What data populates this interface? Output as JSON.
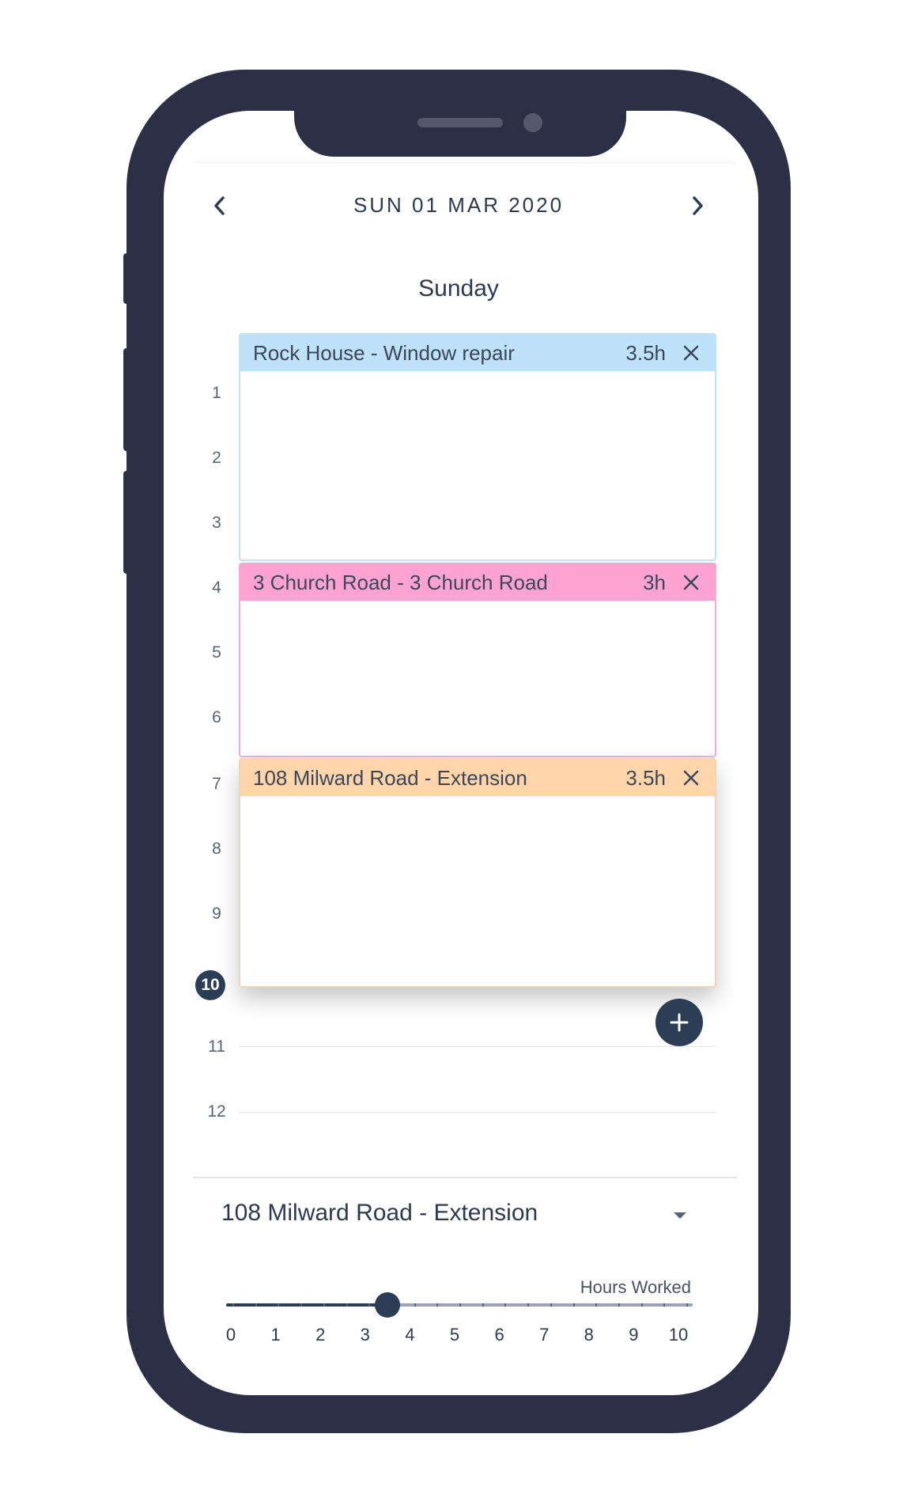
{
  "header": {
    "date_title": "SUN 01 MAR 2020",
    "prev_icon": "chevron-left-icon",
    "next_icon": "chevron-right-icon"
  },
  "day": {
    "label": "Sunday"
  },
  "timeline": {
    "hours": [
      "1",
      "2",
      "3",
      "4",
      "5",
      "6",
      "7",
      "8",
      "9"
    ],
    "current_hour": "10",
    "later_hours": [
      "11",
      "12"
    ]
  },
  "events": [
    {
      "title": "Rock House - Window repair",
      "hours": "3.5h",
      "color": "#bde2f9",
      "close_icon": "close-icon"
    },
    {
      "title": "3 Church Road - 3 Church Road",
      "hours": "3h",
      "color": "#ffa3d3",
      "close_icon": "close-icon"
    },
    {
      "title": "108 Milward Road - Extension",
      "hours": "3.5h",
      "color": "#ffd6ab",
      "close_icon": "close-icon"
    }
  ],
  "add_button": {
    "icon": "plus-icon",
    "label": "+"
  },
  "job_select": {
    "value": "108 Milward Road - Extension",
    "icon": "caret-down-icon"
  },
  "hours_slider": {
    "label": "Hours Worked",
    "min": 0,
    "max": 10,
    "value": 3.5,
    "ticks": [
      "0",
      "1",
      "2",
      "3",
      "4",
      "5",
      "6",
      "7",
      "8",
      "9",
      "10"
    ]
  },
  "colors": {
    "frame": "#2c2f45",
    "accent": "#2c3e56",
    "text": "#2d3a4f"
  }
}
